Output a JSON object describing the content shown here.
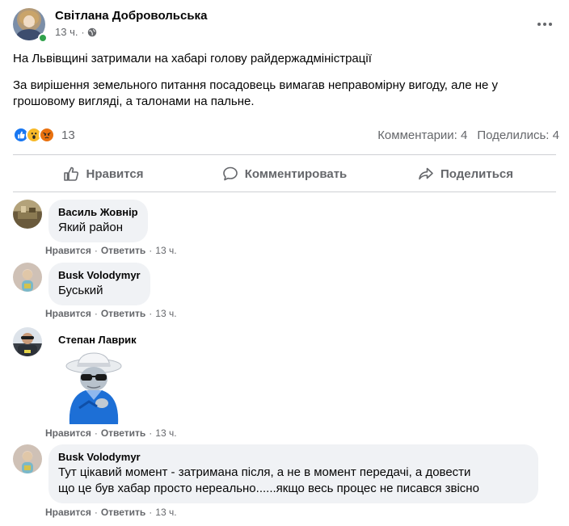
{
  "post": {
    "author": "Світлана Добровольська",
    "time": "13 ч.",
    "title": "На Львівщині затримали на хабарі голову райдержадміністрації",
    "body": "За вирішення земельного питання посадовець вимагав неправомірну вигоду, але не у грошовому вигляді, а талонами на пальне.",
    "reaction_count": "13",
    "comments_stat": "Комментарии: 4",
    "shares_stat": "Поделились: 4",
    "reactions": [
      "like-icon",
      "wow-icon",
      "angry-icon"
    ]
  },
  "actions": {
    "like": "Нравится",
    "comment": "Комментировать",
    "share": "Поделиться"
  },
  "comments": [
    {
      "name": "Василь Жовнір",
      "text": "Який район",
      "like": "Нравится",
      "reply": "Ответить",
      "time": "13 ч."
    },
    {
      "name": "Busk Volodymyr",
      "text": "Буський",
      "like": "Нравится",
      "reply": "Ответить",
      "time": "13 ч."
    },
    {
      "name": "Степан Лаврик",
      "text": "",
      "like": "Нравится",
      "reply": "Ответить",
      "time": "13 ч."
    },
    {
      "name": "Busk Volodymyr",
      "text_line1": "Тут цікавий момент - затримана після, а не в момент передачі, а довести",
      "text_line2": "що це був хабар просто нереально......якщо весь процес не писався звісно",
      "like": "Нравится",
      "reply": "Ответить",
      "time": "13 ч."
    }
  ],
  "colors": {
    "accent": "#1877f2",
    "secondary_text": "#65676b",
    "bubble": "#f0f2f5",
    "online": "#31a24c"
  }
}
